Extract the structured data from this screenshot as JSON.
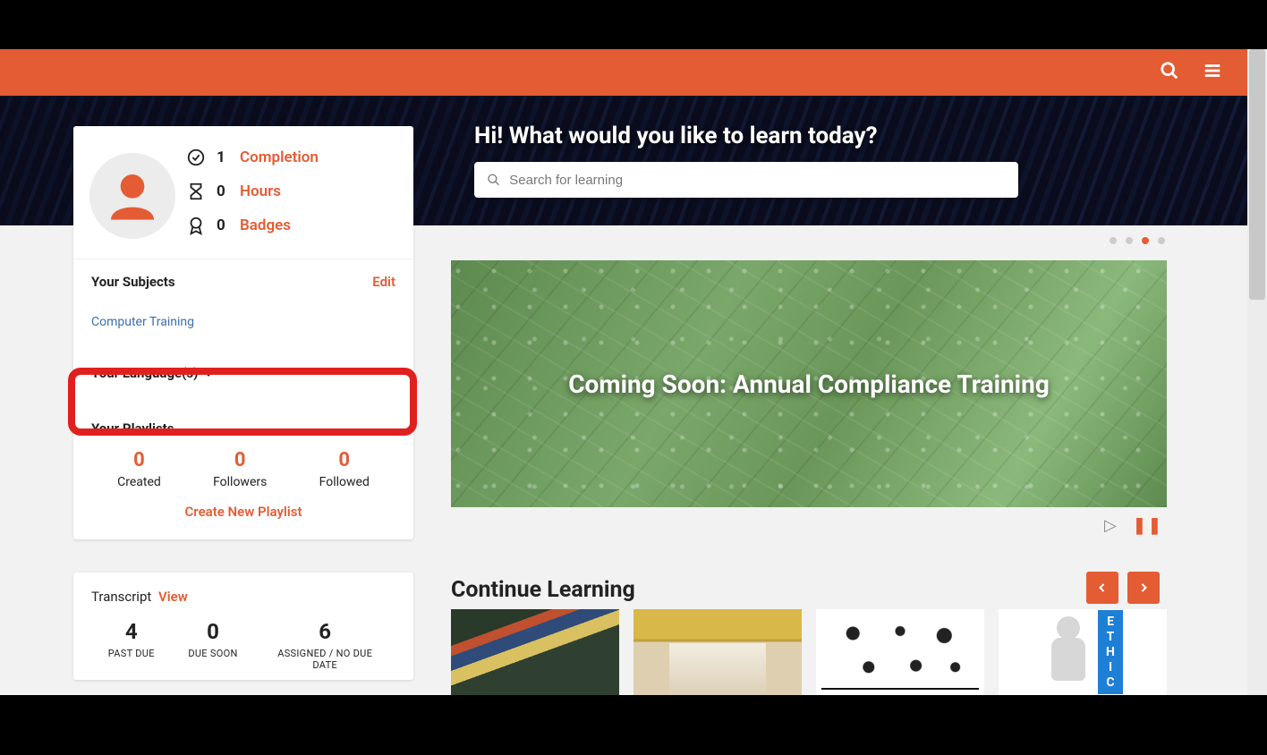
{
  "topbar": {
    "search_aria": "Search",
    "menu_aria": "Menu"
  },
  "hero": {
    "title": "Hi! What would you like to learn today?",
    "search_placeholder": "Search for learning"
  },
  "profile": {
    "stats": {
      "completion": {
        "value": "1",
        "label": "Completion"
      },
      "hours": {
        "value": "0",
        "label": "Hours"
      },
      "badges": {
        "value": "0",
        "label": "Badges"
      }
    }
  },
  "subjects": {
    "title": "Your Subjects",
    "edit": "Edit",
    "items": [
      {
        "label": "Computer Training"
      }
    ]
  },
  "languages": {
    "title": "Your Language(s)"
  },
  "playlists": {
    "title": "Your Playlists",
    "created": {
      "value": "0",
      "label": "Created"
    },
    "followers": {
      "value": "0",
      "label": "Followers"
    },
    "followed": {
      "value": "0",
      "label": "Followed"
    },
    "create_link": "Create New Playlist"
  },
  "transcript": {
    "title": "Transcript",
    "view": "View",
    "past_due": {
      "value": "4",
      "label": "PAST DUE"
    },
    "due_soon": {
      "value": "0",
      "label": "DUE SOON"
    },
    "assigned": {
      "value": "6",
      "label": "ASSIGNED / NO DUE DATE"
    }
  },
  "carousel": {
    "slide_text": "Coming Soon: Annual Compliance Training",
    "active_index": 2,
    "total": 4
  },
  "continue": {
    "title": "Continue Learning"
  },
  "ethics_letters": [
    "E",
    "T",
    "H",
    "I",
    "C"
  ]
}
